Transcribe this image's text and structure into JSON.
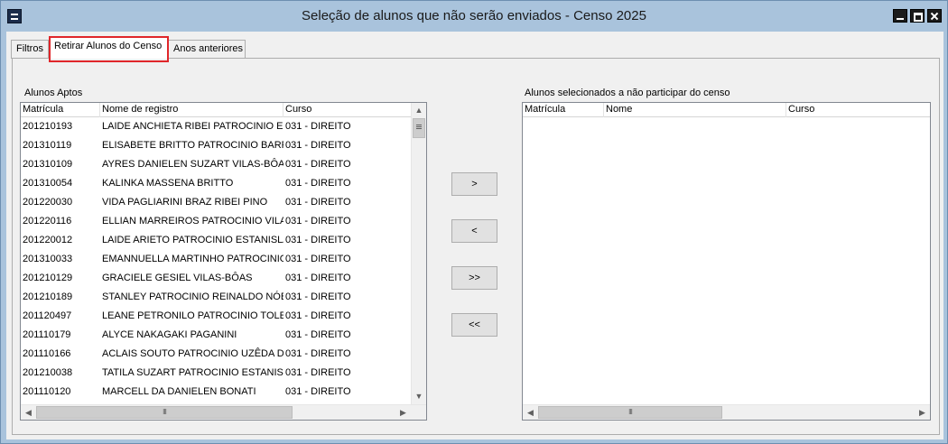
{
  "window": {
    "title": "Seleção de alunos que não serão enviados - Censo 2025"
  },
  "tabs": [
    {
      "label": "Filtros"
    },
    {
      "label": "Retirar Alunos do Censo"
    },
    {
      "label": "Anos anteriores"
    }
  ],
  "left_panel": {
    "title": "Alunos Aptos",
    "columns": [
      "Matrícula",
      "Nome de registro",
      "Curso"
    ],
    "rows": [
      {
        "matricula": "201210193",
        "nome": "LAIDE ANCHIETA RIBEI PATROCINIO ESTANISLAU",
        "curso": "031 - DIREITO"
      },
      {
        "matricula": "201310119",
        "nome": "ELISABETE BRITTO PATROCINIO BARRELA",
        "curso": "031 - DIREITO"
      },
      {
        "matricula": "201310109",
        "nome": "AYRES DANIELEN SUZART VILAS-BÔAS",
        "curso": "031 - DIREITO"
      },
      {
        "matricula": "201310054",
        "nome": "KALINKA MASSENA BRITTO",
        "curso": "031 - DIREITO"
      },
      {
        "matricula": "201220030",
        "nome": "VIDA PAGLIARINI BRAZ RIBEI PINO",
        "curso": "031 - DIREITO"
      },
      {
        "matricula": "201220116",
        "nome": "ELLIAN MARREIROS PATROCINIO VILAS-BÔAS",
        "curso": "031 - DIREITO"
      },
      {
        "matricula": "201220012",
        "nome": "LAIDE ARIETO PATROCINIO ESTANISLAU",
        "curso": "031 - DIREITO"
      },
      {
        "matricula": "201310033",
        "nome": "EMANNUELLA MARTINHO PATROCINIO ESTANISLAU",
        "curso": "031 - DIREITO"
      },
      {
        "matricula": "201210129",
        "nome": "GRACIELE GESIEL VILAS-BÔAS",
        "curso": "031 - DIREITO"
      },
      {
        "matricula": "201210189",
        "nome": "STANLEY PATROCINIO REINALDO NÓBREGA",
        "curso": "031 - DIREITO"
      },
      {
        "matricula": "201120497",
        "nome": "LEANE PETRONILO PATROCINIO TOLEDO",
        "curso": "031 - DIREITO"
      },
      {
        "matricula": "201110179",
        "nome": "ALYCE NAKAGAKI PAGANINI",
        "curso": "031 - DIREITO"
      },
      {
        "matricula": "201110166",
        "nome": "ACLAIS SOUTO PATROCINIO UZÊDA D' OLIVEIRA",
        "curso": "031 - DIREITO"
      },
      {
        "matricula": "201210038",
        "nome": "TATILA SUZART PATROCINIO ESTANISLAU",
        "curso": "031 - DIREITO"
      },
      {
        "matricula": "201110120",
        "nome": "MARCELL DA DANIELEN BONATI",
        "curso": "031 - DIREITO"
      }
    ]
  },
  "right_panel": {
    "title": "Alunos selecionados a não participar do censo",
    "columns": [
      "Matrícula",
      "Nome",
      "Curso"
    ]
  },
  "buttons": {
    "add_one": ">",
    "remove_one": "<",
    "add_all": ">>",
    "remove_all": "<<"
  },
  "scrollbar": {
    "grip": "III"
  },
  "colors": {
    "titlebar": "#a9c3dc",
    "highlight": "#e0262a"
  }
}
